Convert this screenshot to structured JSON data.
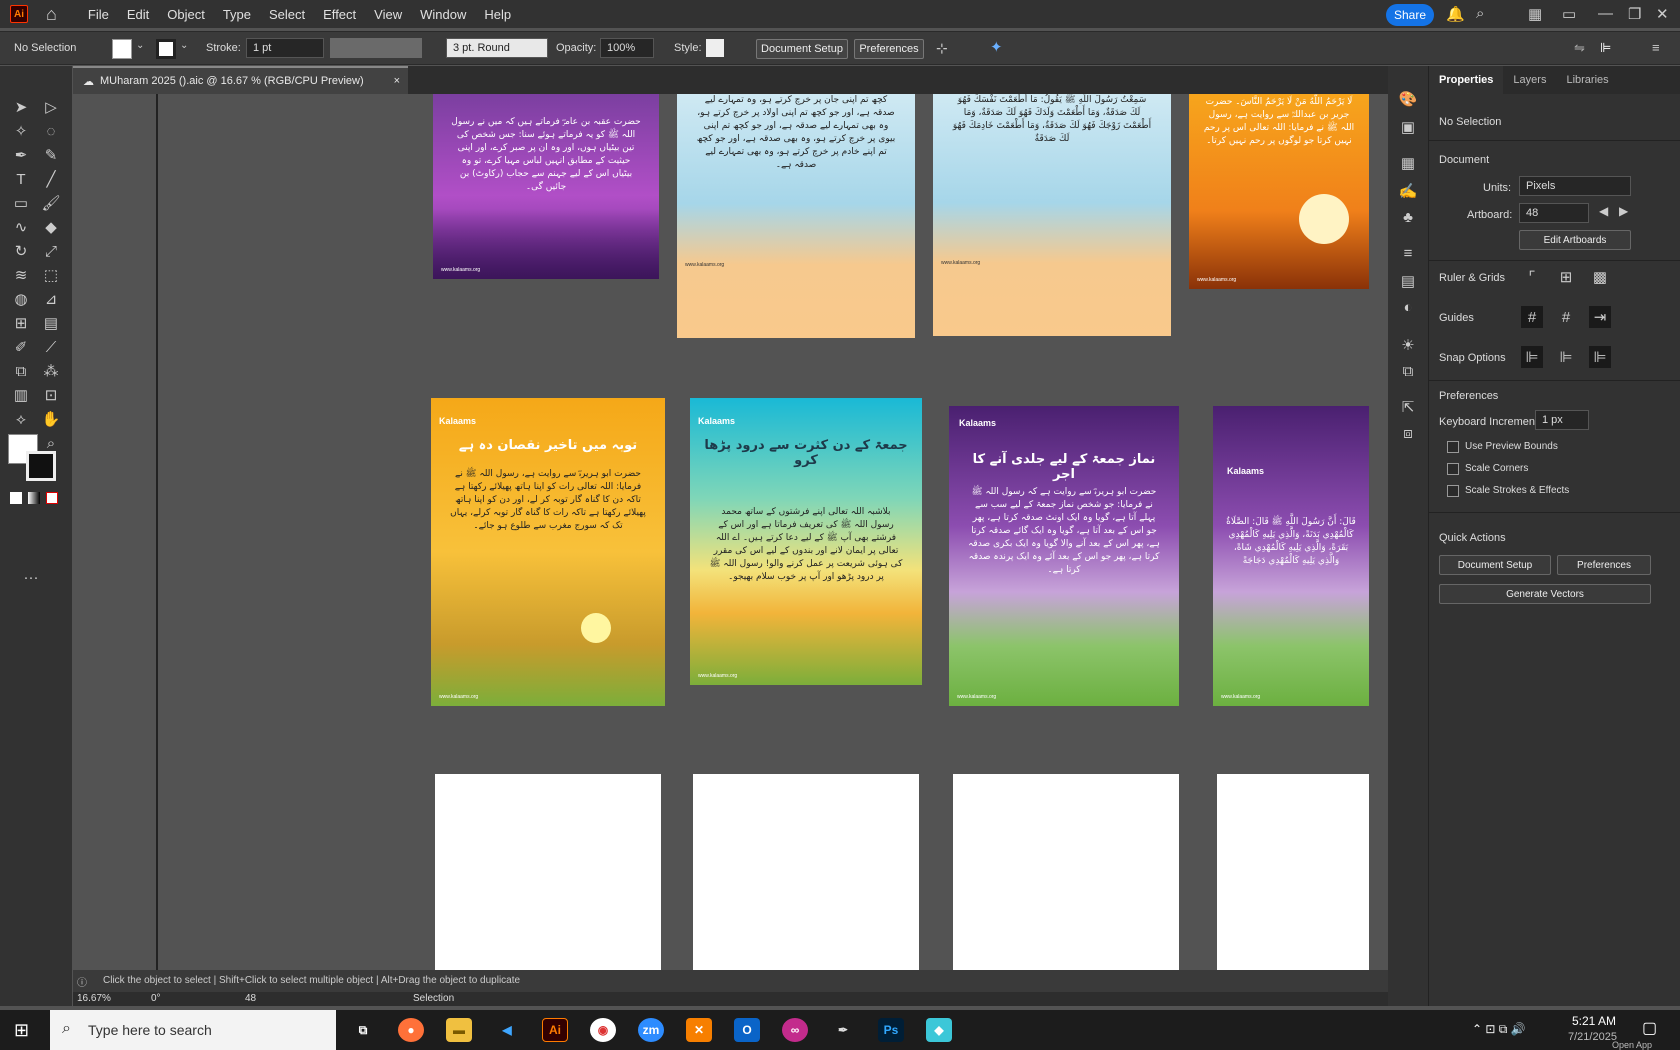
{
  "app": {
    "logo": "Ai",
    "menu": [
      "File",
      "Edit",
      "Object",
      "Type",
      "Select",
      "Effect",
      "View",
      "Window",
      "Help"
    ],
    "share": "Share"
  },
  "control": {
    "selection": "No Selection",
    "stroke_label": "Stroke:",
    "stroke_value": "1 pt",
    "brush": "3 pt. Round",
    "opacity_label": "Opacity:",
    "opacity_value": "100%",
    "style_label": "Style:",
    "doc_setup": "Document Setup",
    "preferences": "Preferences"
  },
  "tab": {
    "title": "MUharam 2025 ().aic @ 16.67 % (RGB/CPU Preview)",
    "close": "×"
  },
  "panel": {
    "tabs": [
      "Properties",
      "Layers",
      "Libraries"
    ],
    "no_selection": "No Selection",
    "document": "Document",
    "units_label": "Units:",
    "units_value": "Pixels",
    "artboard_label": "Artboard:",
    "artboard_value": "48",
    "edit_artboards": "Edit Artboards",
    "ruler_grids": "Ruler & Grids",
    "guides": "Guides",
    "snap": "Snap Options",
    "preferences": "Preferences",
    "kbd_label": "Keyboard Increment:",
    "kbd_value": "1 px",
    "opts": [
      "Use Preview Bounds",
      "Scale Corners",
      "Scale Strokes & Effects"
    ],
    "quick": "Quick Actions",
    "qa_doc": "Document Setup",
    "qa_pref": "Preferences",
    "qa_gen": "Generate Vectors"
  },
  "posters": {
    "brand": "Kalaams",
    "site": "www.kalaams.org",
    "p1_text": "حضرت عقبہ بن عامرؓ فرماتے ہیں کہ میں نے رسول اللہ ﷺ کو یہ فرماتے ہوئے سنا: جس شخص کی تین بیٹیاں ہوں، اور وہ ان پر صبر کرے، اور اپنی حیثیت کے مطابق انہیں لباس مہیا کرے، تو وہ بیٹیاں اس کے لیے جہنم سے حجاب (رکاوٹ) بن جائیں گی۔",
    "p2_text": "کچھ تم اپنی جان پر خرچ کرتے ہو، وہ تمہارے لیے صدقہ ہے، اور جو کچھ تم اپنی اولاد پر خرچ کرتے ہو، وہ بھی تمہارے لیے صدقہ ہے، اور جو کچھ تم اپنی بیوی پر خرچ کرتے ہو، وہ بھی صدقہ ہے، اور جو کچھ تم اپنے خادم پر خرچ کرتے ہو، وہ بھی تمہارے لیے صدقہ ہے۔",
    "p3_text": "سَمِعْتُ رَسُولَ اللَّهِ ﷺ يَقُولُ: مَا أَطْعَمْتَ نَفْسَكَ فَهُوَ لَكَ صَدَقَةٌ، وَمَا أَطْعَمْتَ وَلَدَكَ فَهُوَ لَكَ صَدَقَةٌ، وَمَا أَطْعَمْتَ زَوْجَكَ فَهُوَ لَكَ صَدَقَةٌ، وَمَا أَطْعَمْتَ خَادِمَكَ فَهُوَ لَكَ صَدَقَةٌ",
    "p4_text": "لَا يَرْحَمُ اللَّهُ مَنْ لَا يَرْحَمُ النَّاسَ۔ حضرت جریر بن عبداللہؓ سے روایت ہے، رسول اللہ ﷺ نے فرمایا: اللہ تعالی اس پر رحم نہیں کرتا جو لوگوں پر رحم نہیں کرتا۔",
    "p5_title": "توبہ میں تاخیر نقصان دہ ہے",
    "p5_text": "حضرت ابو ہریرہؓ سے روایت ہے، رسول اللہ ﷺ نے فرمایا: اللہ تعالی رات کو اپنا ہاتھ پھیلائے رکھتا ہے تاکہ دن کا گناہ گار توبہ کر لے، اور دن کو اپنا ہاتھ پھیلائے رکھتا ہے تاکہ رات کا گناہ گار توبہ کرلے، یہاں تک کہ سورج مغرب سے طلوع ہو جائے۔",
    "p6_title": "جمعۃ کے دن کثرت سے درود پڑھا کرو",
    "p6_text": "بلاشبہ اللہ تعالی اپنے فرشتوں کے ساتھ محمد رسول اللہ ﷺ کی تعریف فرماتا ہے اور اس کے فرشتے بھی آپ ﷺ کے لیے دعا کرتے ہیں۔ اے اللہ تعالی پر ایمان لانے اور بندوں کے لیے اس کی مقرر کی ہوئی شریعت پر عمل کرنے والو! رسول اللہ ﷺ پر درود پڑھو اور آپ پر خوب سلام بھیجو۔",
    "p7_title": "نماز جمعۃ کے لیے جلدی آنے کا اجر",
    "p7_text": "حضرت ابو ہریرہؓ سے روایت ہے کہ رسول اللہ ﷺ نے فرمایا: جو شخص نماز جمعۃ کے لیے سب سے پہلے آتا ہے، گویا وہ ایک اونٹ صدقہ کرتا ہے، پھر جو اس کے بعد آتا ہے، گویا وہ ایک گائے صدقہ کرتا ہے، پھر اس کے بعد آنے والا گویا وہ ایک بکری صدقہ کرتا ہے، پھر جو اس کے بعد آئے وہ ایک پرندہ صدقہ کرتا ہے۔",
    "p8_text": "قَالَ: أَنَّ رَسُولَ اللَّهِ ﷺ قَالَ: الصَّلَاةُ كَالْمُهْدِي بَدَنَةً، وَالَّذِي يَلِيهِ كَالْمُهْدِي بَقَرَةً، وَالَّذِي يَلِيهِ كَالْمُهْدِي شَاةً، وَالَّذِي يَلِيهِ كَالْمُهْدِي دَجَاجَةً"
  },
  "status": {
    "hint": "Click the object to select  |  Shift+Click to select multiple object  |  Alt+Drag the object to duplicate",
    "zoom": "16.67%",
    "rotate": "0°",
    "artboard": "48",
    "tool": "Selection"
  },
  "taskbar": {
    "search": "Type here to search",
    "time": "5:21 AM",
    "date": "7/21/2025",
    "open_app": "Open App"
  }
}
